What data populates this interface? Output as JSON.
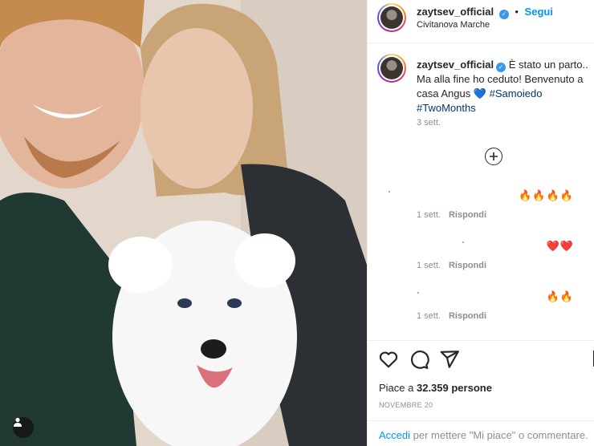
{
  "photo": {
    "alt_icon": "user-tag-icon"
  },
  "header": {
    "username": "zaytsev_official",
    "follow_label": "Segui",
    "separator": "•",
    "location": "Civitanova Marche"
  },
  "caption": {
    "username": "zaytsev_official",
    "text_main": "È stato un parto.. Ma alla fine ho ceduto! Benvenuto a casa Angus",
    "heart": "💙",
    "hashtag_1": "#Samoiedo",
    "hashtag_2": "#TwoMonths",
    "time": "3 sett."
  },
  "comments": [
    {
      "emoji": "🔥🔥🔥🔥",
      "time": "1 sett.",
      "reply_label": "Rispondi"
    },
    {
      "emoji": "❤️❤️",
      "time": "1 sett.",
      "reply_label": "Rispondi"
    },
    {
      "emoji": "🔥🔥",
      "time": "1 sett.",
      "reply_label": "Rispondi"
    }
  ],
  "likes": {
    "prefix": "Piace a ",
    "count": "32.359 persone"
  },
  "date": "NOVEMBRE 20",
  "login": {
    "link": "Accedi",
    "rest": " per mettere \"Mi piace\" o commentare."
  },
  "colors": {
    "accent": "#0095f6",
    "verified": "#3897f0",
    "hashtag": "#00376b"
  },
  "icons": [
    "heart-icon",
    "comment-icon",
    "share-icon",
    "bookmark-icon",
    "plus-circle-icon",
    "user-tag-icon",
    "verified-icon"
  ]
}
